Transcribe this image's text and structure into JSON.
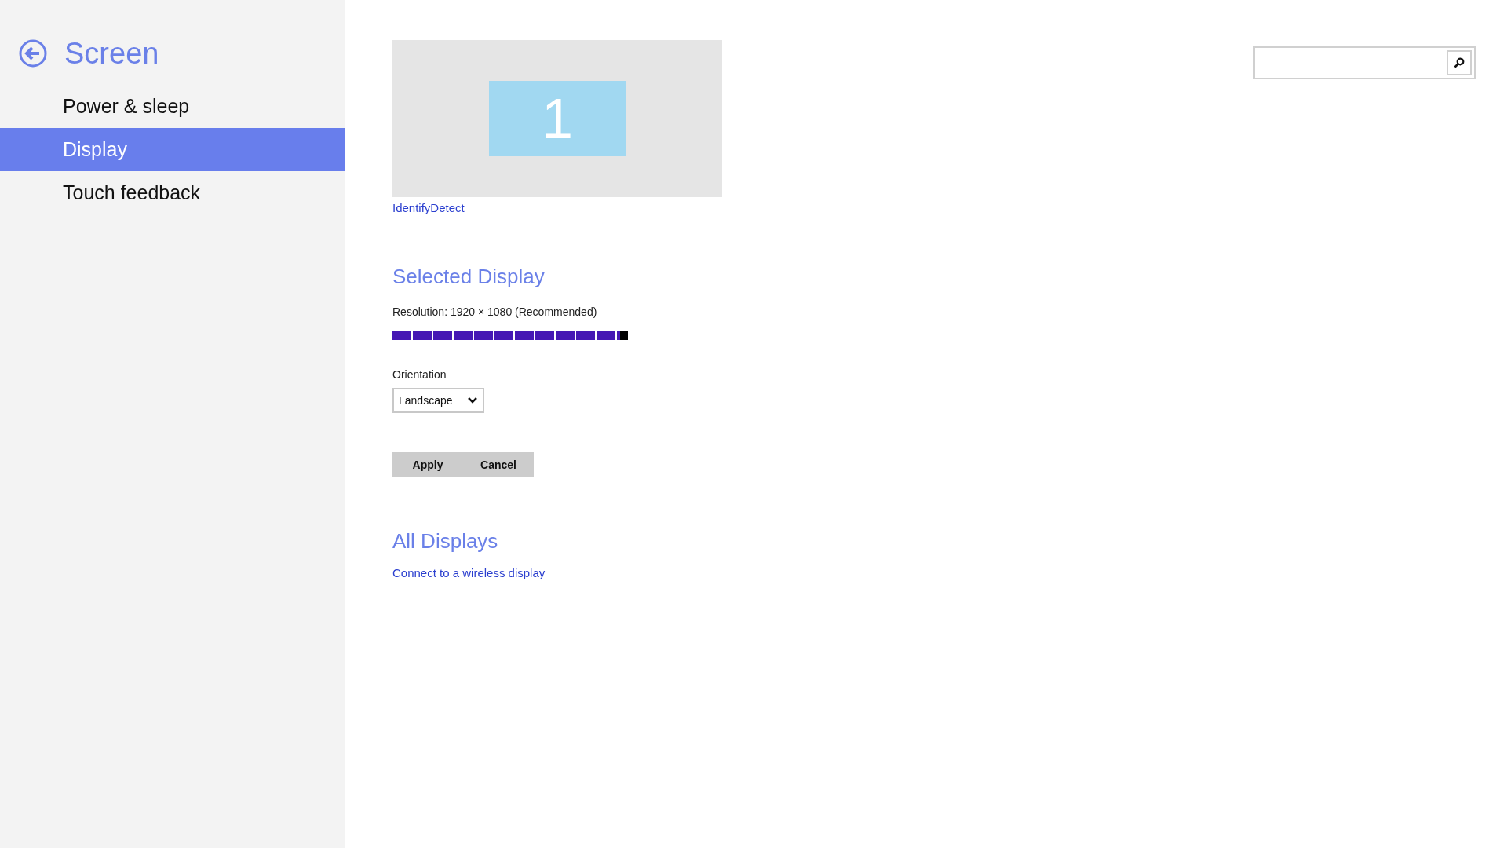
{
  "sidebar": {
    "title": "Screen",
    "items": [
      {
        "label": "Power & sleep",
        "selected": false
      },
      {
        "label": "Display",
        "selected": true
      },
      {
        "label": "Touch feedback",
        "selected": false
      }
    ]
  },
  "preview": {
    "monitor_number": "1",
    "link": "IdentifyDetect"
  },
  "selected_display": {
    "heading": "Selected Display",
    "resolution_label": "Resolution: 1920 × 1080 (Recommended)",
    "resolution_slider": {
      "level": 1.0
    },
    "orientation_label": "Orientation",
    "orientation": {
      "value": "Landscape"
    },
    "buttons": [
      "Apply",
      "Cancel"
    ]
  },
  "all_displays": {
    "heading": "All Displays",
    "link": "Connect to a wireless display"
  }
}
